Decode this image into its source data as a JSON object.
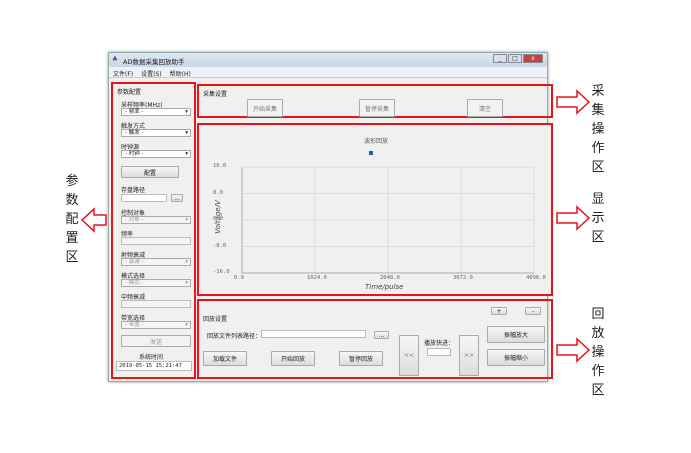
{
  "window": {
    "title": "AD数据采集回放助手",
    "menu": [
      "文件(F)",
      "设置(S)",
      "帮助(H)"
    ]
  },
  "params": {
    "title": "参数配置",
    "sample_rate_label": "采样频率(MHz)",
    "sample_rate_value": "- 频率 -",
    "trigger_label": "触发方式",
    "trigger_value": "- 触发 -",
    "clock_label": "时钟源",
    "clock_value": "- 时钟 -",
    "config_button": "配置",
    "save_path_label": "存盘路径",
    "browse": "...",
    "control_label": "控制对象",
    "control_value": "- 对象 -",
    "freq_label": "频率",
    "rf_atten_label": "射频衰减",
    "rf_atten_value": "- 衰减 -",
    "mode_label": "模式选择",
    "mode_value": "- 模式 -",
    "if_atten_label": "中频衰减",
    "bw_label": "带宽选择",
    "bw_value": "- 带宽 -",
    "send_button": "发送",
    "sys_time_label": "系统时间",
    "sys_time": "2019-05-15 15:21:47"
  },
  "acquire": {
    "title": "采集设置",
    "start": "开始采集",
    "pause": "暂停采集",
    "clear": "清空"
  },
  "chart_data": {
    "type": "line",
    "title": "波形回放",
    "xlabel": "Time/pulse",
    "ylabel": "Voltage/V",
    "xlim": [
      0,
      4096
    ],
    "ylim": [
      -16,
      16
    ],
    "xticks": [
      "0.0",
      "1024.0",
      "2048.0",
      "3072.0",
      "4096.0"
    ],
    "yticks": [
      "16.0",
      "8.0",
      "0.0",
      "-8.0",
      "-16.0"
    ],
    "series": [],
    "grid": true,
    "legend_color": "#1f5fa8"
  },
  "playback": {
    "title": "回放设置",
    "path_label": "回放文件列表路径：",
    "browse": "...",
    "load": "加载文件",
    "start": "开始回放",
    "pause": "暂停回放",
    "rewind": "<<",
    "forward": ">>",
    "speed_label": "播放快进：",
    "plus": "+",
    "minus": "-",
    "amp_up": "振幅放大",
    "amp_down": "振幅缩小"
  },
  "annotations": {
    "acquire": "采集操作区",
    "display": "显示区",
    "playback": "回放操作区",
    "params": "参数配置区"
  }
}
